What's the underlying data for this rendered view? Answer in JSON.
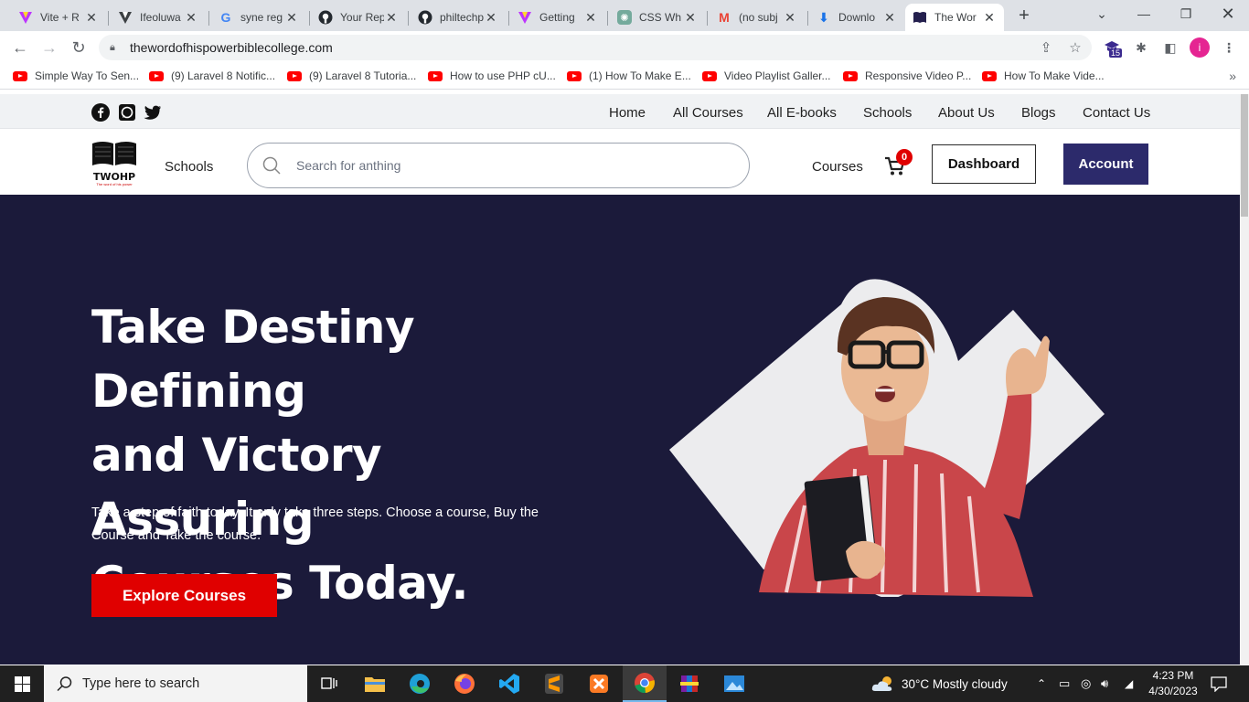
{
  "browser": {
    "tabs": [
      {
        "title": "Vite + R",
        "favicon": "vite-icon"
      },
      {
        "title": "Ifeoluwa",
        "favicon": "vite-icon"
      },
      {
        "title": "syne reg",
        "favicon": "google-icon"
      },
      {
        "title": "Your Rep",
        "favicon": "github-icon"
      },
      {
        "title": "philtechp",
        "favicon": "github-icon"
      },
      {
        "title": "Getting",
        "favicon": "vite-icon"
      },
      {
        "title": "CSS Wh",
        "favicon": "chatgpt-icon"
      },
      {
        "title": "(no subj",
        "favicon": "gmail-icon"
      },
      {
        "title": "Downlo",
        "favicon": "download-icon"
      },
      {
        "title": "The Wor",
        "favicon": "book-icon"
      }
    ],
    "url": "thewordofhispowerbiblecollege.com",
    "extension_badge": "15",
    "profile_initial": "i",
    "bookmarks": [
      "Simple Way To Sen...",
      "(9) Laravel 8 Notific...",
      "(9) Laravel 8 Tutoria...",
      "How to use PHP cU...",
      "(1) How To Make E...",
      "Video Playlist Galler...",
      "Responsive Video P...",
      "How To Make Vide..."
    ]
  },
  "site": {
    "top_nav": [
      "Home",
      "All Courses",
      "All E-books",
      "Schools",
      "About Us",
      "Blogs",
      "Contact Us"
    ],
    "logo_text": "TWOHP",
    "logo_tagline": "The word of his power",
    "schools_link": "Schools",
    "search_placeholder": "Search for anthing",
    "courses_link": "Courses",
    "cart_count": "0",
    "dashboard_button": "Dashboard",
    "account_button": "Account",
    "hero": {
      "title_lines": [
        "Take Destiny Defining",
        "and Victory Assuring",
        "Courses Today."
      ],
      "text_lines": [
        "Take a step of faith today. It only take three steps. Choose a course, Buy the",
        "Course and Take the course."
      ],
      "button": "Explore Courses"
    },
    "colors": {
      "hero_bg": "#1b1a3a",
      "accent_red": "#e00000",
      "account_bg": "#2c2a6b"
    }
  },
  "taskbar": {
    "search_placeholder": "Type here to search",
    "weather": "30°C  Mostly cloudy",
    "time": "4:23 PM",
    "date": "4/30/2023"
  }
}
